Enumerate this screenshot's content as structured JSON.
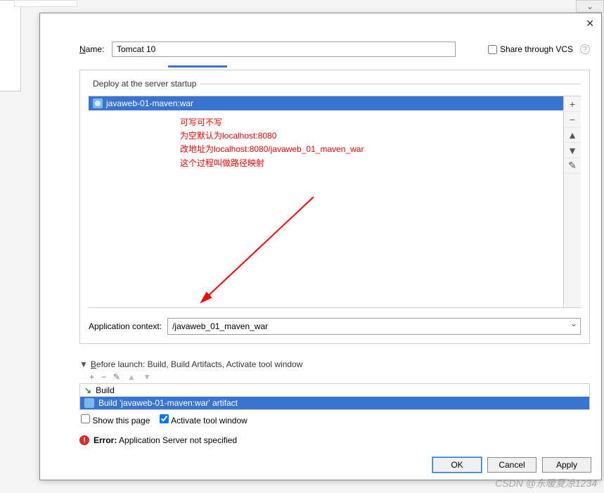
{
  "nameLabel": "Name:",
  "nameValue": "Tomcat 10",
  "shareVcs": "Share through VCS",
  "deployLegend": "Deploy at the server startup",
  "artifact": "javaweb-01-maven:war",
  "annotation": {
    "l1": "可写可不写",
    "l2": "为空默认为localhost:8080",
    "l3": "改地址为localhost:8080/javaweb_01_maven_war",
    "l4": "这个过程叫做路径映射"
  },
  "contextLabel": "Application context:",
  "contextValue": "/javaweb_01_maven_war",
  "beforeLaunch": {
    "title": "Before launch: Build, Build Artifacts, Activate tool window",
    "rowBuild": "Build",
    "rowArtifact": "Build 'javaweb-01-maven:war' artifact"
  },
  "showPage": "Show this page",
  "activateTool": "Activate tool window",
  "error": {
    "label": "Error:",
    "msg": " Application Server not specified"
  },
  "buttons": {
    "ok": "OK",
    "cancel": "Cancel",
    "apply": "Apply"
  },
  "sideBtns": {
    "add": "+",
    "remove": "−",
    "up": "▲",
    "down": "▼",
    "edit": "✎"
  },
  "blToolbar": {
    "add": "+",
    "remove": "−",
    "edit": "✎",
    "up": "▲",
    "down": "▼"
  },
  "watermark": "CSDN @东暖夏凉1234",
  "rightStub": "⌄"
}
